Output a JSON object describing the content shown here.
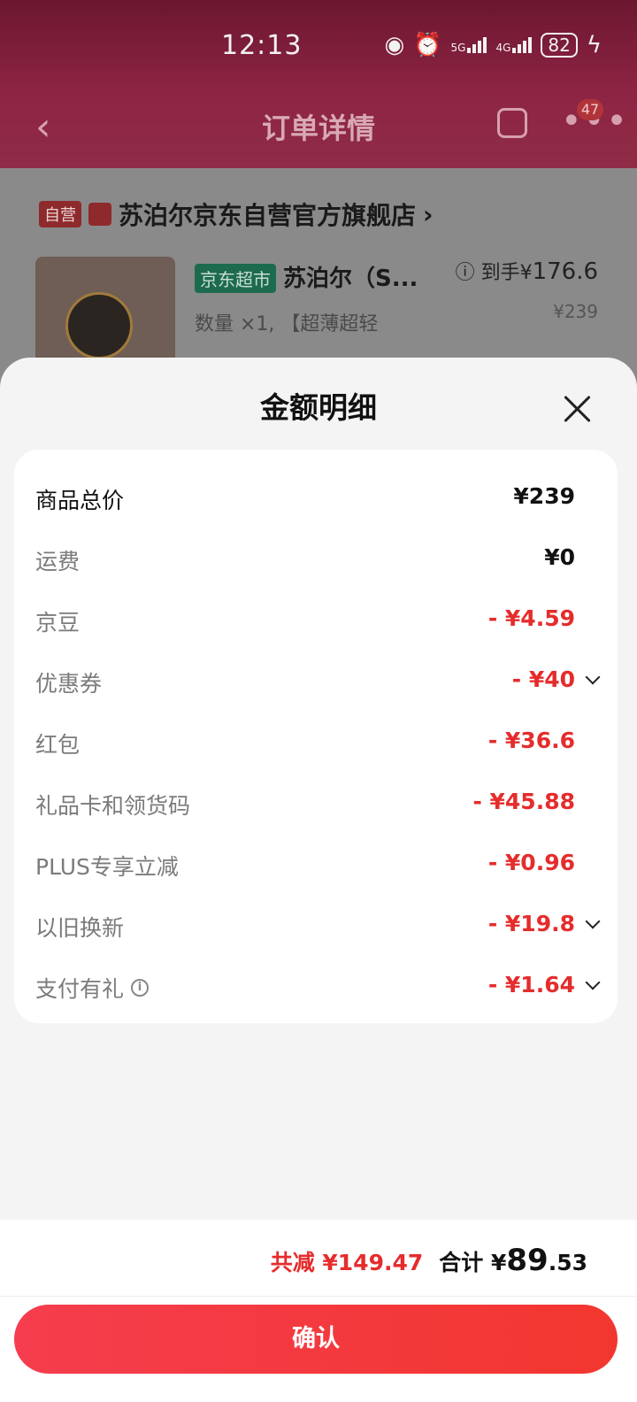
{
  "status_bar": {
    "time": "12:13",
    "battery": "82",
    "net1": "5G",
    "net2": "4G"
  },
  "nav": {
    "title": "订单详情",
    "badge": "47"
  },
  "store": {
    "tag": "自营",
    "name": "苏泊尔京东自营官方旗舰店",
    "arrow": "›"
  },
  "product": {
    "channel_tag": "京东超市",
    "name": "苏泊尔（S...",
    "price_label": "到手¥",
    "price": "176.6",
    "qty": "数量 ×1, 【超薄超轻",
    "orig_price": "¥239"
  },
  "sheet": {
    "title": "金额明细",
    "rows": [
      {
        "label": "商品总价",
        "value": "¥239"
      },
      {
        "label": "运费",
        "value": "¥0"
      },
      {
        "label": "京豆",
        "value": "- ¥4.59"
      },
      {
        "label": "优惠券",
        "value": "- ¥40"
      },
      {
        "label": "红包",
        "value": "- ¥36.6"
      },
      {
        "label": "礼品卡和领货码",
        "value": "- ¥45.88"
      },
      {
        "label": "PLUS专享立减",
        "value": "- ¥0.96"
      },
      {
        "label": "以旧换新",
        "value": "- ¥19.8"
      },
      {
        "label": "支付有礼",
        "value": "- ¥1.64"
      }
    ]
  },
  "footer": {
    "saved": "共减 ¥149.47",
    "total_label": "合计 ¥",
    "total_int": "89",
    "total_dec": ".53",
    "confirm": "确认"
  },
  "colors": {
    "accent_red": "#e52c2c",
    "button_red": "#f2362f"
  }
}
